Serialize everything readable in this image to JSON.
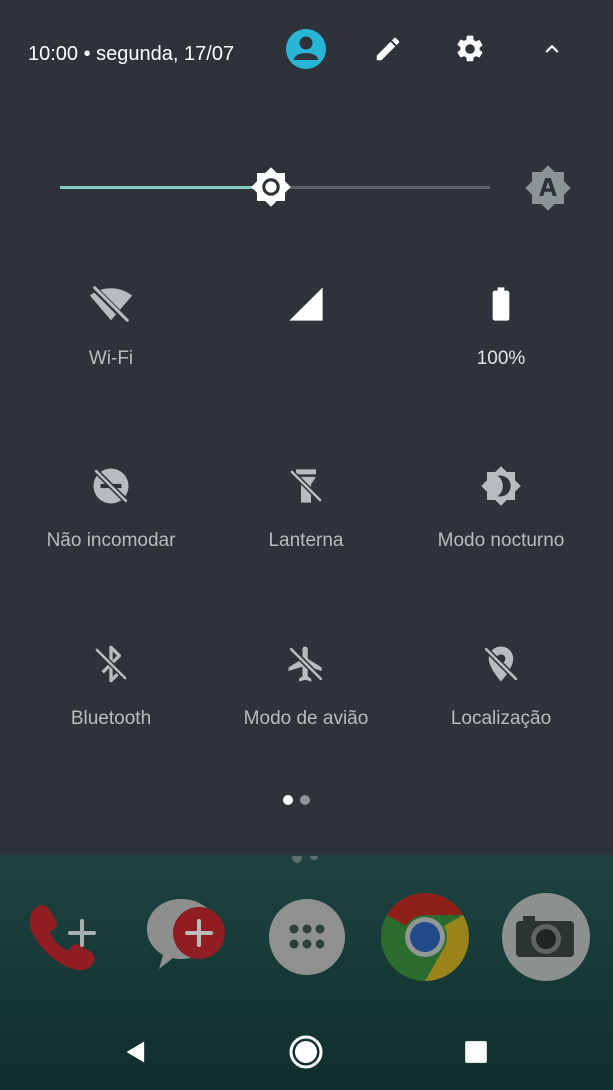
{
  "header": {
    "status_text": "10:00 • segunda, 17/07",
    "icons": [
      "avatar-icon",
      "edit-icon",
      "gear-icon",
      "chevron-up-icon"
    ],
    "avatar_color": "#29b6d6"
  },
  "brightness": {
    "level": 0.49,
    "accent": "#80cbc4",
    "auto_icon": "brightness-auto-icon"
  },
  "tiles": [
    {
      "label": "Wi-Fi",
      "icon": "wifi-off-icon"
    },
    {
      "label": "",
      "icon": "cellular-signal-icon"
    },
    {
      "label": "100%",
      "icon": "battery-full-icon"
    },
    {
      "label": "Não incomodar",
      "icon": "do-not-disturb-off-icon"
    },
    {
      "label": "Lanterna",
      "icon": "flashlight-off-icon"
    },
    {
      "label": "Modo nocturno",
      "icon": "night-mode-icon"
    },
    {
      "label": "Bluetooth",
      "icon": "bluetooth-off-icon"
    },
    {
      "label": "Modo de avião",
      "icon": "airplane-mode-off-icon"
    },
    {
      "label": "Localização",
      "icon": "location-off-icon"
    }
  ],
  "pager": {
    "pages": 2,
    "current": 1
  },
  "dock": {
    "apps": [
      "phone-app-icon",
      "messaging-app-icon",
      "app-drawer-icon",
      "chrome-app-icon",
      "camera-app-icon"
    ]
  },
  "navbar": {
    "buttons": [
      "back-icon",
      "home-icon",
      "recents-icon"
    ]
  }
}
